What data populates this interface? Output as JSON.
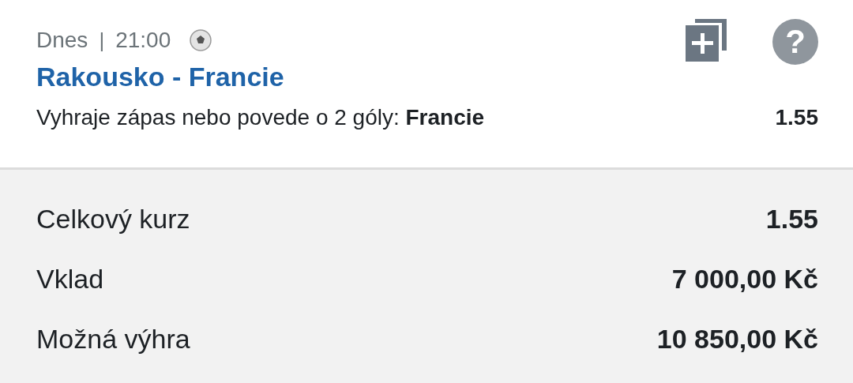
{
  "bet": {
    "day": "Dnes",
    "separator": "|",
    "time": "21:00",
    "help_icon": "?",
    "match": "Rakousko - Francie",
    "market": "Vyhraje zápas nebo povede o 2 góly: **Francie**",
    "odds": "1.55"
  },
  "summary": [
    {
      "label": "Celkový kurz",
      "value": "1.55"
    },
    {
      "label": "Vklad",
      "value": "7 000,00 Kč"
    },
    {
      "label": "Možná výhra",
      "value": "10 850,00 Kč"
    }
  ]
}
